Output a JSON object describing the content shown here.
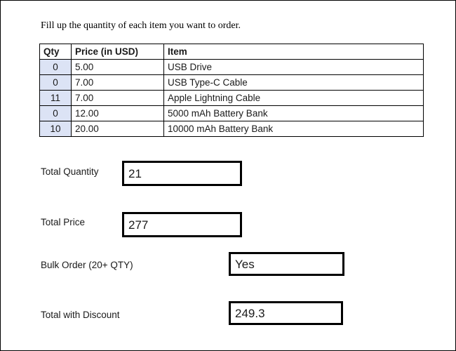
{
  "page": {
    "intro_text": "Fill up the quantity of each item you want to order."
  },
  "order_table": {
    "columns": [
      "Qty",
      "Price (in USD)",
      "Item"
    ],
    "rows": [
      {
        "qty": "0",
        "price": "5.00",
        "item": "USB Drive"
      },
      {
        "qty": "0",
        "price": "7.00",
        "item": "USB Type-C Cable"
      },
      {
        "qty": "11",
        "price": "7.00",
        "item": "Apple Lightning Cable"
      },
      {
        "qty": "0",
        "price": "12.00",
        "item": "5000 mAh Battery Bank"
      },
      {
        "qty": "10",
        "price": "20.00",
        "item": "10000 mAh Battery Bank"
      }
    ],
    "qty_cell_background": "#dce3f5"
  },
  "summary": {
    "total_quantity": {
      "label": "Total Quantity",
      "value": "21"
    },
    "total_price": {
      "label": "Total Price",
      "value": "277"
    },
    "bulk_order": {
      "label": "Bulk Order (20+ QTY)",
      "value": "Yes"
    },
    "total_with_discount": {
      "label": "Total with Discount",
      "value": "249.3"
    }
  }
}
